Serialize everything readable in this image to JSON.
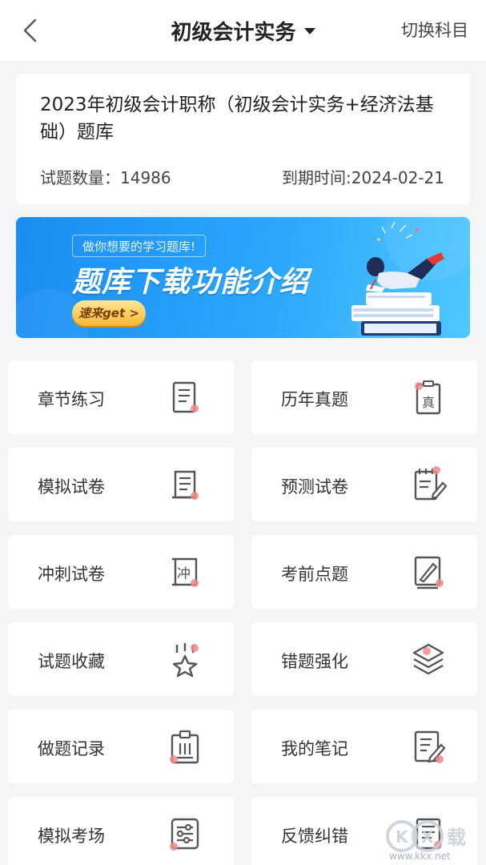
{
  "header": {
    "title": "初级会计实务",
    "right_label": "切换科目"
  },
  "info": {
    "title": "2023年初级会计职称（初级会计实务+经济法基础）题库",
    "count_text": "试题数量：14986",
    "expire_text": "到期时间:2024-02-21"
  },
  "banner": {
    "subtitle": "做你想要的学习题库!",
    "title": "题库下载功能介绍",
    "cta": "速来get >"
  },
  "menu": [
    {
      "label": "章节练习",
      "icon": "document-icon"
    },
    {
      "label": "历年真题",
      "icon": "past-exam-icon"
    },
    {
      "label": "模拟试卷",
      "icon": "scroll-icon"
    },
    {
      "label": "预测试卷",
      "icon": "checklist-pencil-icon"
    },
    {
      "label": "冲刺试卷",
      "icon": "sprint-scroll-icon"
    },
    {
      "label": "考前点题",
      "icon": "rocket-board-icon"
    },
    {
      "label": "试题收藏",
      "icon": "star-icon"
    },
    {
      "label": "错题强化",
      "icon": "layers-icon"
    },
    {
      "label": "做题记录",
      "icon": "clipboard-icon"
    },
    {
      "label": "我的笔记",
      "icon": "note-pencil-icon"
    },
    {
      "label": "模拟考场",
      "icon": "sliders-icon"
    },
    {
      "label": "反馈纠错",
      "icon": "feedback-doc-icon"
    }
  ],
  "colors": {
    "accent_dot": "#f08a8a",
    "icon_stroke": "#555555",
    "banner_blue": "#1b8df2",
    "page_bg": "#f4f5f7"
  },
  "watermark": {
    "text": "KKX下载",
    "url": "www.kkx.net"
  }
}
